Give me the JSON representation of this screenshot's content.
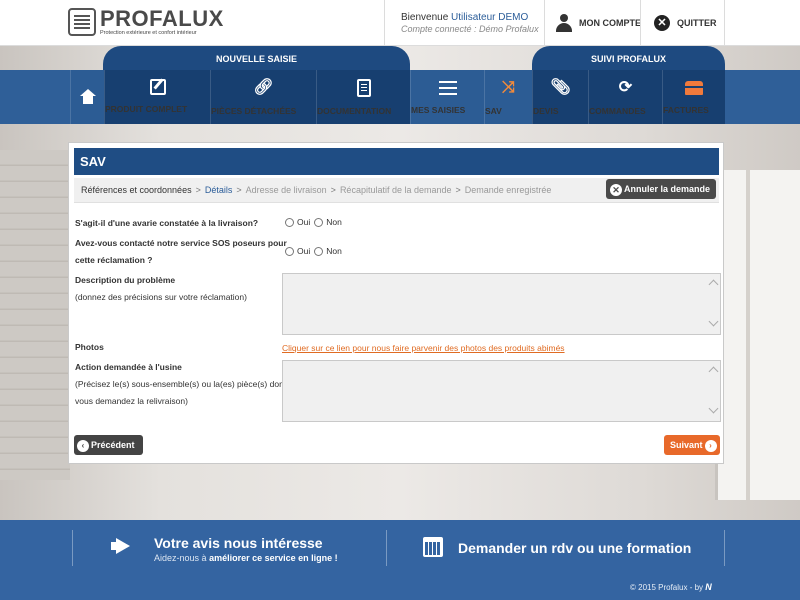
{
  "header": {
    "logo_text": "PROFALUX",
    "logo_tagline": "Protection extérieure et confort intérieur",
    "welcome_prefix": "Bienvenue",
    "welcome_user": "Utilisateur DEMO",
    "connected_account": "Compte connecté : Démo Profalux",
    "my_account_label": "MON COMPTE",
    "quit_label": "QUITTER"
  },
  "nav": {
    "group_new_entry": "NOUVELLE SAISIE",
    "group_follow": "SUIVI PROFALUX",
    "items": [
      {
        "label": "PRODUIT COMPLET"
      },
      {
        "label": "PIÈCES DÉTACHÉES"
      },
      {
        "label": "DOCUMENTATION"
      },
      {
        "label": "MES SAISIES"
      },
      {
        "label": "SAV"
      },
      {
        "label": "DEVIS"
      },
      {
        "label": "COMMANDES"
      },
      {
        "label": "FACTURES"
      }
    ]
  },
  "panel": {
    "title": "SAV",
    "steps": [
      {
        "label": "Références et coordonnées"
      },
      {
        "label": "Détails"
      },
      {
        "label": "Adresse de livraison"
      },
      {
        "label": "Récapitulatif de la demande"
      },
      {
        "label": "Demande enregistrée"
      }
    ],
    "step_separator": ">",
    "cancel_label": "Annuler la demande",
    "q1": "S'agit-il d'une avarie constatée à la livraison?",
    "q2_line1": "Avez-vous contacté notre service SOS poseurs pour",
    "q2_line2": "cette réclamation ?",
    "yes": "Oui",
    "no": "Non",
    "description_label": "Description du problème",
    "description_hint": "(donnez des précisions sur votre réclamation)",
    "photos_label": "Photos",
    "photos_link": "Cliquer sur ce lien pour nous faire parvenir des photos des produits abimés",
    "action_label": "Action demandée à l'usine",
    "action_hint_line1": "(Précisez le(s) sous-ensemble(s) ou la(es) pièce(s) dont",
    "action_hint_line2": "vous demandez la relivraison)",
    "prev_label": "Précédent",
    "next_label": "Suivant"
  },
  "footer": {
    "feedback_title": "Votre avis nous intéresse",
    "feedback_sub_prefix": "Aidez-nous à",
    "feedback_sub_bold": "améliorer ce service en ligne !",
    "appointment_title": "Demander un rdv ou une formation",
    "copyright": "© 2015 Profalux - by",
    "copyright_brand": "N"
  }
}
